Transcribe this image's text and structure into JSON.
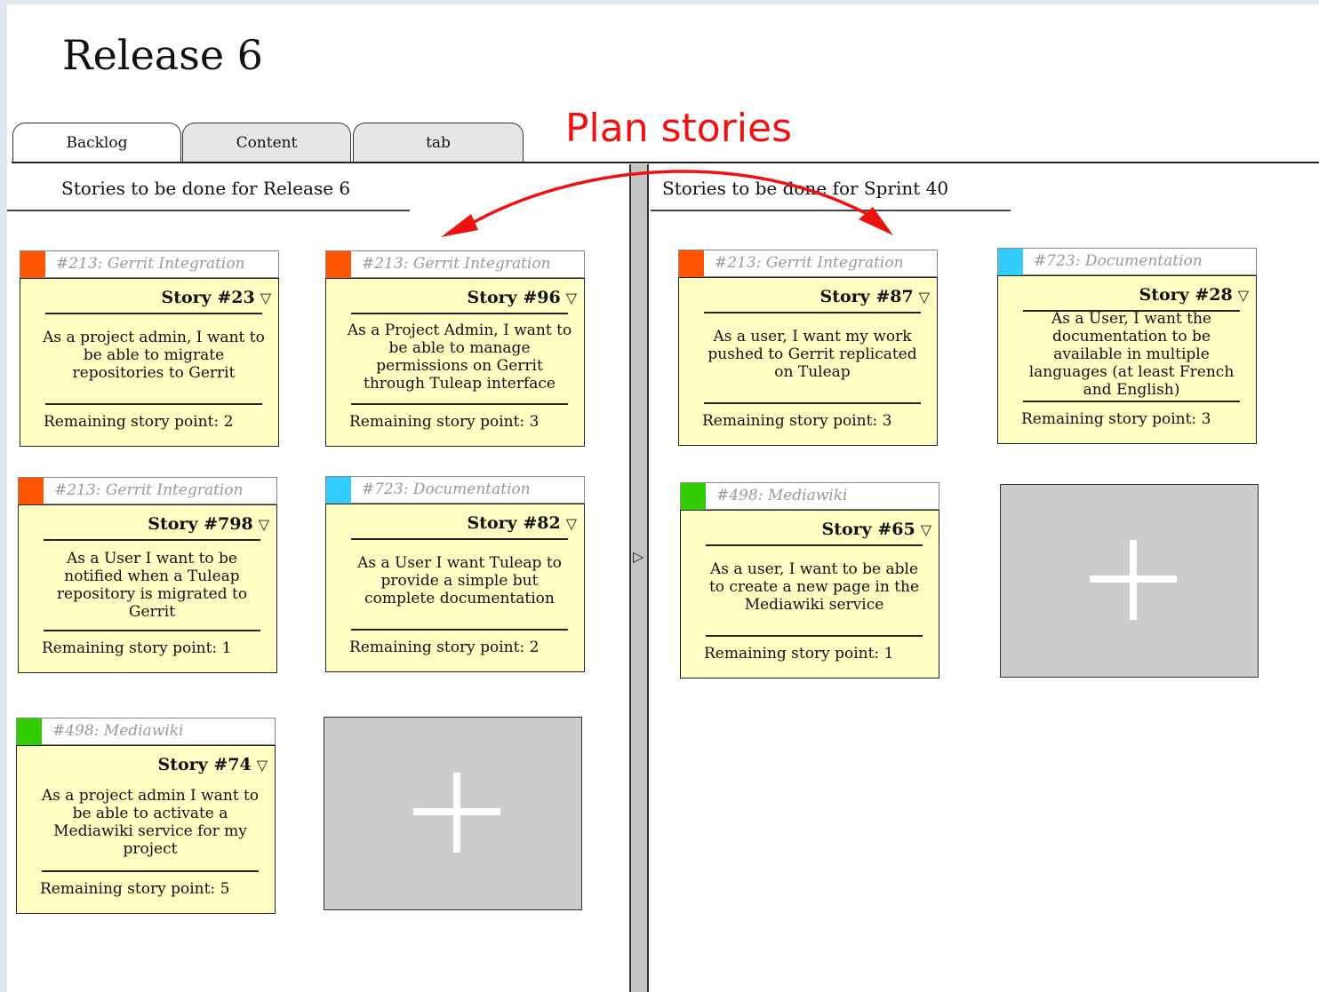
{
  "page": {
    "title": "Release 6"
  },
  "tabs": [
    {
      "label": "Backlog",
      "active": true
    },
    {
      "label": "Content",
      "active": false
    },
    {
      "label": "tab",
      "active": false
    }
  ],
  "annotation": {
    "text": "Plan stories",
    "color": "#ee1111"
  },
  "left_panel": {
    "title": "Stories to be done for Release 6"
  },
  "right_panel": {
    "title": "Stories to be done for Sprint 40"
  },
  "colors": {
    "orange": "#ff5500",
    "cyan": "#33ccff",
    "green": "#33cc00",
    "card_yellow": "#ffffc4"
  },
  "left_cards": [
    {
      "epic": "#213: Gerrit Integration",
      "epic_color": "#ff5500",
      "story": "Story #23",
      "caret": "▽",
      "desc": "As a project admin, I want to be able to migrate repositories to Gerrit",
      "remaining": "Remaining story point: 2"
    },
    {
      "epic": "#213: Gerrit Integration",
      "epic_color": "#ff5500",
      "story": "Story #96",
      "caret": "▽",
      "desc": "As a Project Admin, I want to be able to manage permissions on Gerrit through Tuleap interface",
      "remaining": "Remaining story point: 3"
    },
    {
      "epic": "#213: Gerrit Integration",
      "epic_color": "#ff5500",
      "story": "Story #798",
      "caret": "▽",
      "desc": "As a User I want to be notified when a Tuleap repository is migrated to Gerrit",
      "remaining": "Remaining story point: 1"
    },
    {
      "epic": "#723: Documentation",
      "epic_color": "#33ccff",
      "story": "Story #82",
      "caret": "▽",
      "desc": "As a User I want Tuleap to provide a simple but complete documentation",
      "remaining": "Remaining story point: 2"
    },
    {
      "epic": "#498: Mediawiki",
      "epic_color": "#33cc00",
      "story": "Story #74",
      "caret": "▽",
      "desc": "As a project admin I want to be able to activate a Mediawiki service for my project",
      "remaining": "Remaining story point: 5"
    }
  ],
  "right_cards": [
    {
      "epic": "#213: Gerrit Integration",
      "epic_color": "#ff5500",
      "story": "Story #87",
      "caret": "▽",
      "desc": "As a user, I want my work pushed to Gerrit replicated on Tuleap",
      "remaining": "Remaining story point: 3"
    },
    {
      "epic": "#723: Documentation",
      "epic_color": "#33ccff",
      "story": "Story #28",
      "caret": "▽",
      "desc": "As a User, I want the documentation to be available in multiple languages (at least French and English)",
      "remaining": "Remaining story point: 3"
    },
    {
      "epic": "#498: Mediawiki",
      "epic_color": "#33cc00",
      "story": "Story #65",
      "caret": "▽",
      "desc": "As a user, I want to be able to create a new page in the Mediawiki service",
      "remaining": "Remaining story point: 1"
    }
  ]
}
